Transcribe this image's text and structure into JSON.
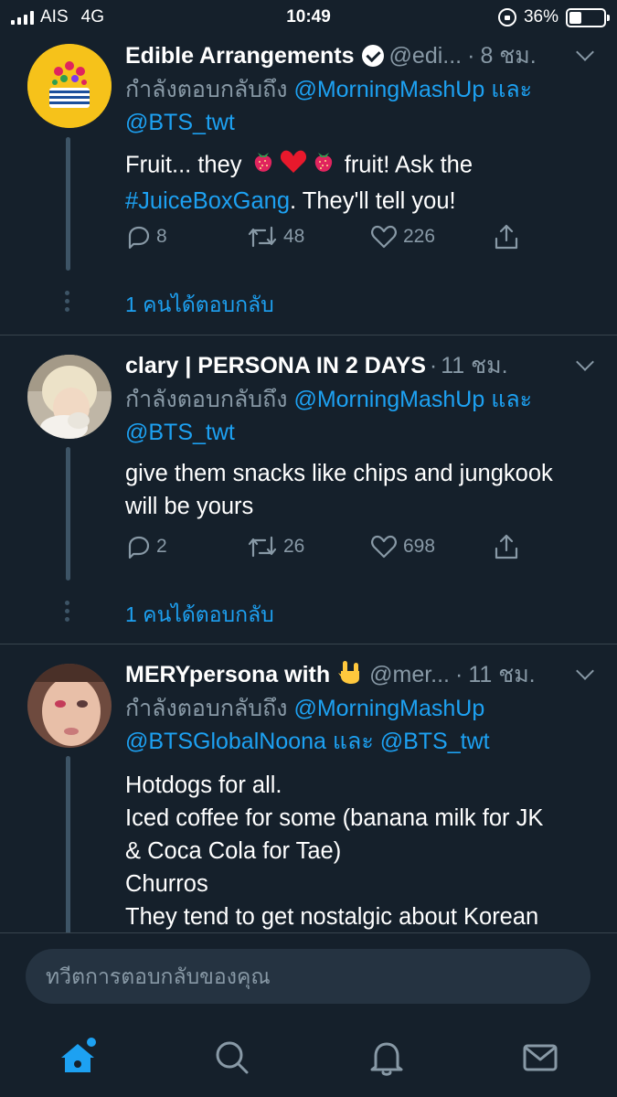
{
  "status_bar": {
    "carrier": "AIS",
    "network": "4G",
    "time": "10:49",
    "battery": "36%",
    "battery_level": 0.36
  },
  "tweets": [
    {
      "name": "Edible Arrangements",
      "verified": true,
      "handle": "@edi...",
      "time": "8 ชม.",
      "reply_prefix": "กำลังตอบกลับถึง",
      "reply_mentions": [
        "@MorningMashUp",
        "และ",
        "@BTS_twt"
      ],
      "body_part1": "Fruit... they",
      "emojis": [
        "strawberry",
        "red-heart",
        "strawberry"
      ],
      "body_part2": "fruit! Ask the",
      "hashtag": "#JuiceBoxGang",
      "body_part3": ". They'll tell you!",
      "replies": "8",
      "retweets": "48",
      "likes": "226",
      "show_replies": "1 คนได้ตอบกลับ"
    },
    {
      "name": "clary | PERSONA IN 2 DAYS",
      "verified": false,
      "time": "11 ชม.",
      "reply_prefix": "กำลังตอบกลับถึง",
      "reply_mentions": [
        "@MorningMashUp",
        "และ",
        "@BTS_twt"
      ],
      "body_line1": "give them snacks like chips and jungkook",
      "body_line2": "will be yours",
      "replies": "2",
      "retweets": "26",
      "likes": "698",
      "show_replies": "1 คนได้ตอบกลับ"
    },
    {
      "name": "MERYpersona with",
      "name_emoji": "rock-on-hand",
      "handle": "@mer...",
      "time": "11 ชม.",
      "reply_prefix": "กำลังตอบกลับถึง",
      "reply_mentions": [
        "@MorningMashUp",
        "@BTSGlobalNoona",
        "และ",
        "@BTS_twt"
      ],
      "body_lines": [
        "Hotdogs for all.",
        "Iced coffee for some (banana milk for JK",
        "& Coca Cola for Tae)",
        "Churros",
        "They tend to get nostalgic about Korean"
      ]
    }
  ],
  "reply_placeholder": "ทวีตการตอบกลับของคุณ",
  "tabs": [
    "home-icon",
    "search-icon",
    "notifications-icon",
    "messages-icon"
  ],
  "colors": {
    "background": "#15202b",
    "accent": "#1da1f2",
    "secondary_text": "#8899a6",
    "divider": "#38444d"
  }
}
